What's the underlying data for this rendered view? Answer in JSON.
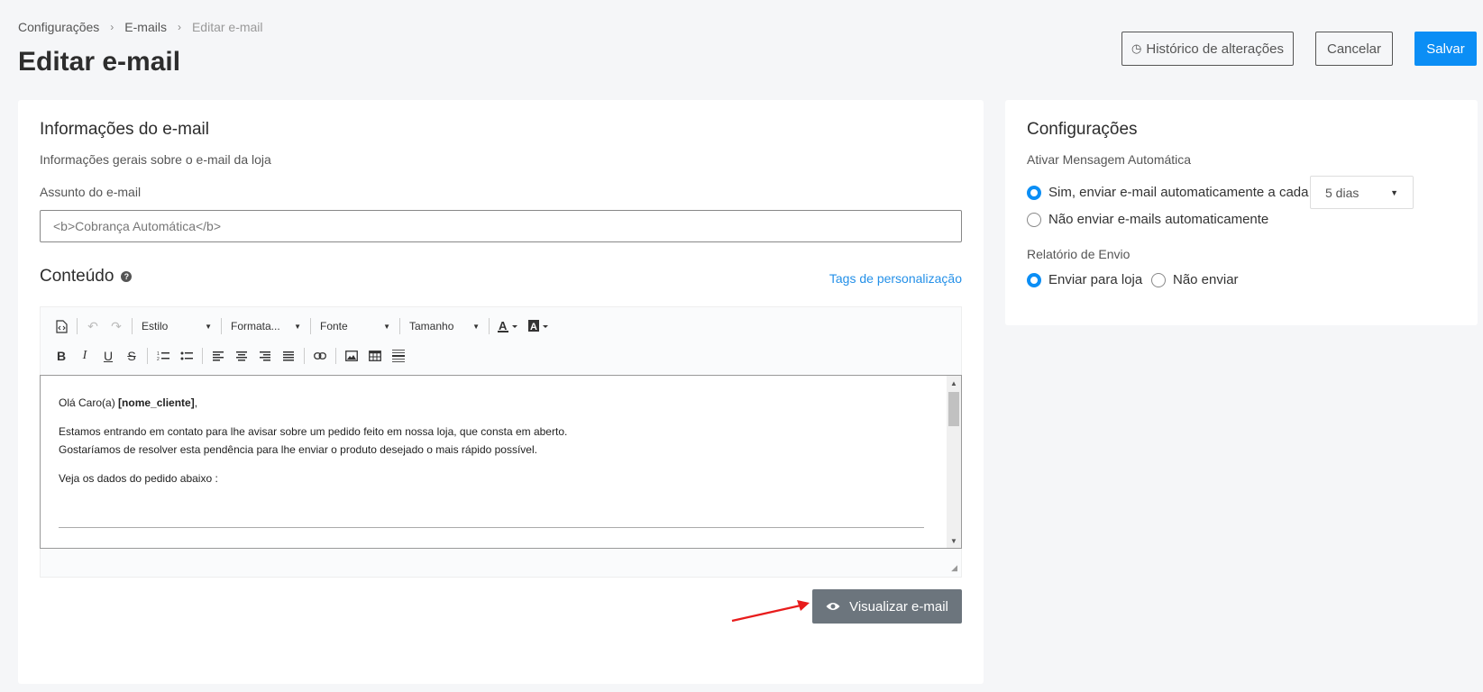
{
  "breadcrumb": {
    "items": [
      "Configurações",
      "E-mails",
      "Editar e-mail"
    ]
  },
  "page": {
    "title": "Editar e-mail"
  },
  "actions": {
    "history_label": "Histórico de alterações",
    "cancel_label": "Cancelar",
    "save_label": "Salvar"
  },
  "email_info": {
    "title": "Informações do e-mail",
    "subtitle": "Informações gerais sobre o e-mail da loja",
    "subject_label": "Assunto do e-mail",
    "subject_value": "<b>Cobrança Automática</b>"
  },
  "content": {
    "title": "Conteúdo",
    "tags_link": "Tags de personalização",
    "toolbar": {
      "style": "Estilo",
      "format": "Formata...",
      "font": "Fonte",
      "size": "Tamanho"
    },
    "body": {
      "greeting_prefix": "Olá Caro(a) ",
      "greeting_tag": "[nome_cliente]",
      "greeting_suffix": ",",
      "line1": "Estamos entrando em contato para lhe avisar sobre um pedido feito em nossa loja, que consta em aberto.",
      "line2": "Gostaríamos de resolver esta pendência para lhe enviar o produto desejado o mais rápido possível.",
      "line3": "Veja os dados do pedido abaixo :"
    },
    "preview_label": "Visualizar e-mail"
  },
  "settings": {
    "title": "Configurações",
    "auto_label": "Ativar Mensagem Automática",
    "auto_yes": "Sim, enviar e-mail automaticamente a cada",
    "auto_no": "Não enviar e-mails automaticamente",
    "interval_value": "5 dias",
    "report_label": "Relatório de Envio",
    "report_store": "Enviar para loja",
    "report_none": "Não enviar"
  },
  "colors": {
    "primary": "#0b8ef5",
    "secondary_button": "#6c757d",
    "link": "#2490e8",
    "arrow": "#e81c1c"
  }
}
